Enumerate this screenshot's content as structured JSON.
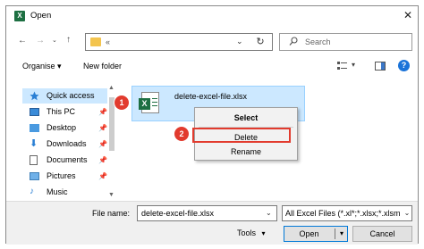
{
  "window": {
    "title": "Open",
    "app_icon": "X",
    "close_symbol": "✕"
  },
  "address_bar": {
    "path": "«",
    "search_placeholder": "Search"
  },
  "command_bar": {
    "organise_label": "Organise ▾",
    "new_folder_label": "New folder"
  },
  "nav_pane": {
    "items": [
      {
        "label": "Quick access",
        "icon": "star-icon",
        "selected": true
      },
      {
        "label": "This PC",
        "icon": "computer-icon"
      },
      {
        "label": "Desktop",
        "icon": "desktop-icon"
      },
      {
        "label": "Downloads",
        "icon": "download-icon"
      },
      {
        "label": "Documents",
        "icon": "document-icon"
      },
      {
        "label": "Pictures",
        "icon": "picture-icon"
      },
      {
        "label": "Music",
        "icon": "music-icon"
      }
    ]
  },
  "file": {
    "name": "delete-excel-file.xlsx",
    "icon": "excel-file-icon"
  },
  "context_menu": {
    "items": [
      {
        "label": "Select"
      },
      {
        "label": "Delete"
      },
      {
        "label": "Rename"
      }
    ]
  },
  "annotations": {
    "step1": "1",
    "step2": "2"
  },
  "bottom": {
    "file_name_label": "File name:",
    "file_name_value": "delete-excel-file.xlsx",
    "file_type_value": "All Excel Files (*.xl*;*.xlsx;*.xlsm",
    "tools_label": "Tools",
    "open_label": "Open",
    "cancel_label": "Cancel"
  },
  "colors": {
    "accent_red": "#e23b2e",
    "excel_green": "#1d6f42",
    "selection_blue": "#cce8ff",
    "help_blue": "#1a73d9"
  }
}
